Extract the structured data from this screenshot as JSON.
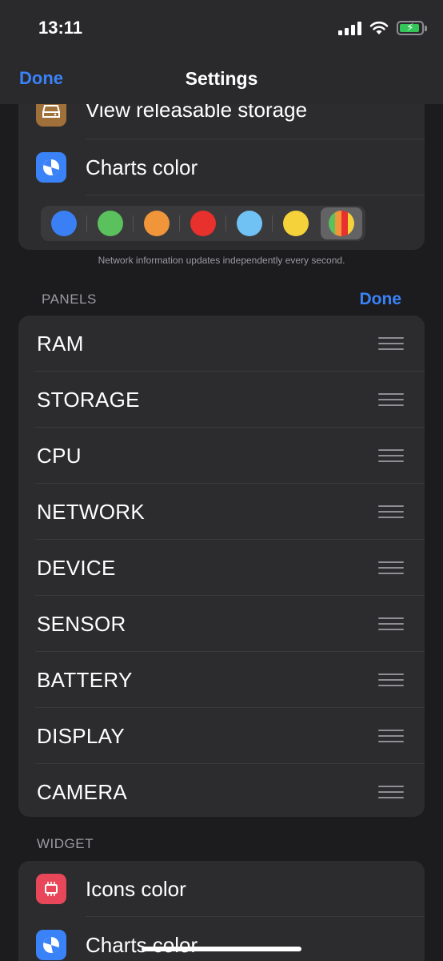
{
  "status": {
    "time": "13:11"
  },
  "nav": {
    "done_label": "Done",
    "title": "Settings"
  },
  "top_group": {
    "rows": [
      {
        "label": "View releasable storage",
        "icon": "storage-icon",
        "color": "#a0703a"
      },
      {
        "label": "Charts color",
        "icon": "pie-chart-icon",
        "color": "#3a82f7"
      }
    ],
    "swatches": [
      {
        "name": "blue",
        "color": "#3b7ff5"
      },
      {
        "name": "green",
        "color": "#5ac15d"
      },
      {
        "name": "orange",
        "color": "#f0953a"
      },
      {
        "name": "red",
        "color": "#e8302c"
      },
      {
        "name": "light-blue",
        "color": "#70c2f5"
      },
      {
        "name": "yellow",
        "color": "#f5d13a"
      },
      {
        "name": "multicolor",
        "selected": true
      }
    ],
    "footnote": "Network information updates independently every second."
  },
  "panels": {
    "header": "PANELS",
    "done_label": "Done",
    "items": [
      "RAM",
      "STORAGE",
      "CPU",
      "NETWORK",
      "DEVICE",
      "SENSOR",
      "BATTERY",
      "DISPLAY",
      "CAMERA"
    ]
  },
  "widget": {
    "header": "WIDGET",
    "rows": [
      {
        "label": "Icons color",
        "icon": "chip-icon",
        "color": "#e8475a"
      },
      {
        "label": "Charts color",
        "icon": "pie-chart-icon",
        "color": "#3a82f7"
      }
    ]
  }
}
